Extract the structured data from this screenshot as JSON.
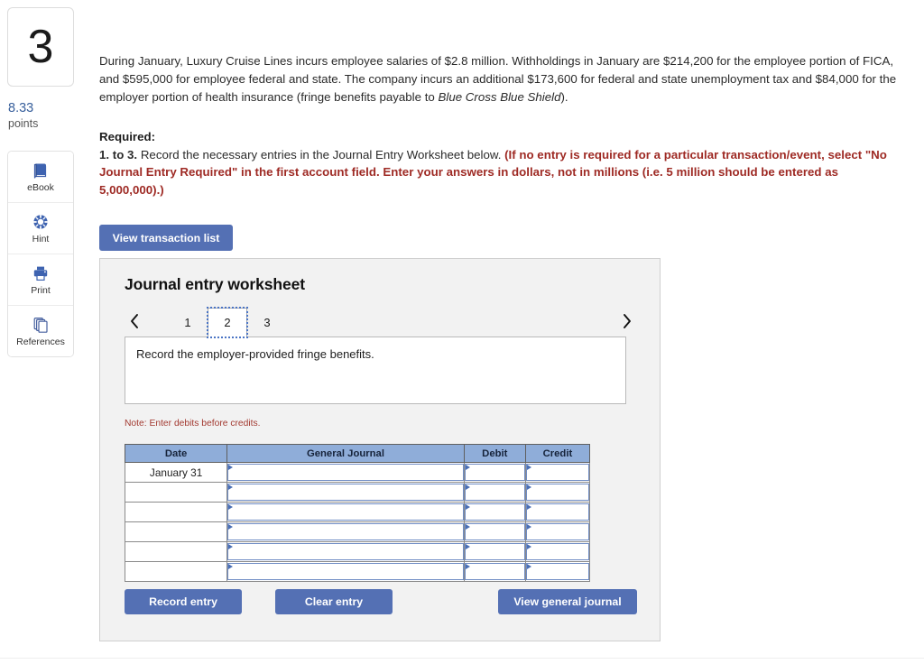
{
  "question": {
    "number": "3",
    "points_value": "8.33",
    "points_label": "points",
    "body_part1": "During January, Luxury Cruise Lines incurs employee salaries of $2.8 million. Withholdings in January are $214,200 for the employee portion of FICA, and $595,000 for employee federal and state. The company incurs an additional $173,600 for federal and state unemployment tax and $84,000 for the employer portion of health insurance (fringe benefits payable to ",
    "body_italic": "Blue Cross Blue Shield",
    "body_part2": ")."
  },
  "required": {
    "heading": "Required:",
    "prefix_bold": "1. to 3.",
    "plain_text": " Record the necessary entries in the Journal Entry Worksheet below. ",
    "red_text": "(If no entry is required for a particular transaction/event, select \"No Journal Entry Required\" in the first account field. Enter your answers in dollars, not in millions (i.e. 5 million should be entered as 5,000,000).)"
  },
  "tools": [
    {
      "label": "eBook",
      "icon": "ebook-icon"
    },
    {
      "label": "Hint",
      "icon": "hint-icon"
    },
    {
      "label": "Print",
      "icon": "print-icon"
    },
    {
      "label": "References",
      "icon": "references-icon"
    }
  ],
  "toolbar": {
    "view_transaction_list": "View transaction list"
  },
  "worksheet": {
    "title": "Journal entry worksheet",
    "tabs": [
      "1",
      "2",
      "3"
    ],
    "active_tab": "2",
    "prev_label": "‹",
    "next_label": "›",
    "description": "Record the employer-provided fringe benefits.",
    "note": "Note: Enter debits before credits.",
    "columns": [
      "Date",
      "General Journal",
      "Debit",
      "Credit"
    ],
    "rows": [
      {
        "date": "January 31",
        "general_journal": "",
        "debit": "",
        "credit": ""
      },
      {
        "date": "",
        "general_journal": "",
        "debit": "",
        "credit": ""
      },
      {
        "date": "",
        "general_journal": "",
        "debit": "",
        "credit": ""
      },
      {
        "date": "",
        "general_journal": "",
        "debit": "",
        "credit": ""
      },
      {
        "date": "",
        "general_journal": "",
        "debit": "",
        "credit": ""
      },
      {
        "date": "",
        "general_journal": "",
        "debit": "",
        "credit": ""
      }
    ],
    "buttons": {
      "record_entry": "Record entry",
      "clear_entry": "Clear entry",
      "view_general_journal": "View general journal"
    }
  },
  "colors": {
    "button_blue": "#5470b4",
    "table_header_blue": "#8fadd9",
    "red_emphasis": "#9e2a24",
    "points_blue": "#39609c",
    "panel_grey": "#f2f2f2"
  }
}
